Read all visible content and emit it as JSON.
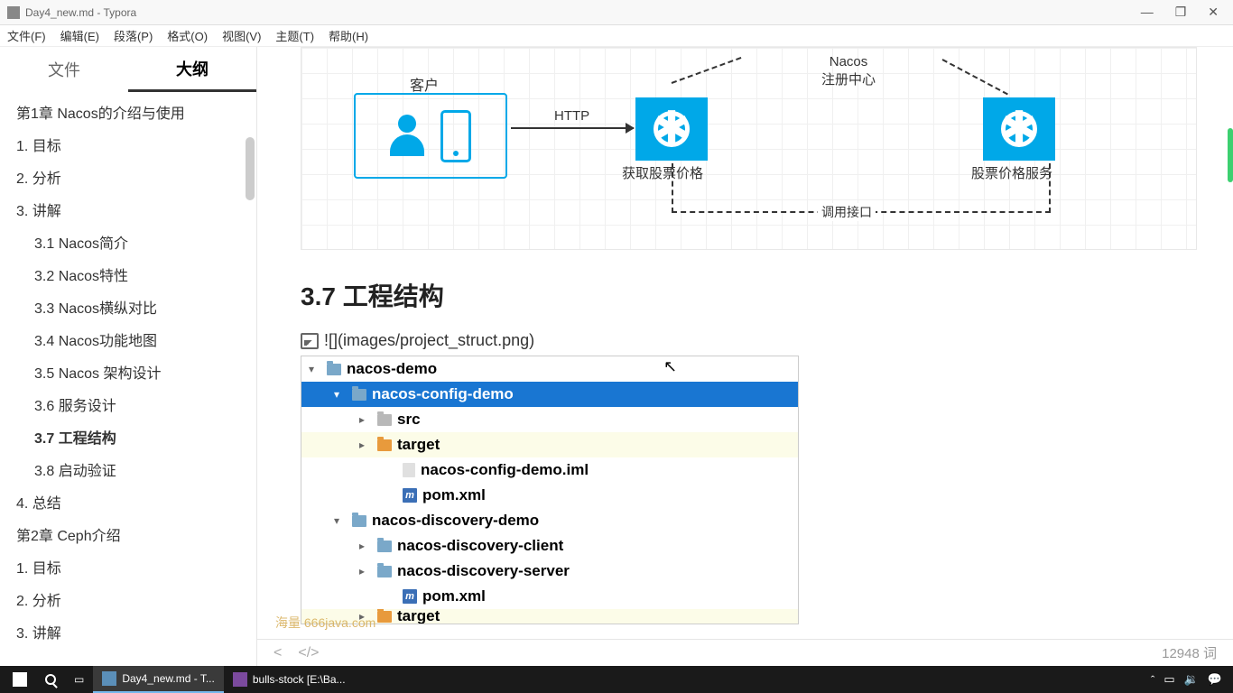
{
  "window": {
    "title": "Day4_new.md - Typora",
    "controls": {
      "min": "—",
      "max": "❐",
      "close": "✕"
    }
  },
  "menu": [
    "文件(F)",
    "编辑(E)",
    "段落(P)",
    "格式(O)",
    "视图(V)",
    "主题(T)",
    "帮助(H)"
  ],
  "sidebar": {
    "tabs": {
      "files": "文件",
      "outline": "大纲"
    },
    "outline": [
      {
        "label": "第1章 Nacos的介绍与使用",
        "level": 1,
        "truncated": true
      },
      {
        "label": "1. 目标",
        "level": 1
      },
      {
        "label": "2. 分析",
        "level": 1
      },
      {
        "label": "3. 讲解",
        "level": 1
      },
      {
        "label": "3.1 Nacos简介",
        "level": 2
      },
      {
        "label": "3.2 Nacos特性",
        "level": 2
      },
      {
        "label": "3.3 Nacos横纵对比",
        "level": 2
      },
      {
        "label": "3.4 Nacos功能地图",
        "level": 2
      },
      {
        "label": "3.5 Nacos 架构设计",
        "level": 2
      },
      {
        "label": "3.6 服务设计",
        "level": 2
      },
      {
        "label": "3.7 工程结构",
        "level": 2,
        "active": true
      },
      {
        "label": "3.8 启动验证",
        "level": 2
      },
      {
        "label": "4. 总结",
        "level": 1
      },
      {
        "label": "第2章 Ceph介绍",
        "level": 1
      },
      {
        "label": "1. 目标",
        "level": 1
      },
      {
        "label": "2. 分析",
        "level": 1
      },
      {
        "label": "3. 讲解",
        "level": 1
      }
    ]
  },
  "diagram": {
    "client": "客户",
    "http": "HTTP",
    "svc1": "获取股票价格",
    "nacos": "Nacos\n注册中心",
    "svc2": "股票价格服务",
    "call": "调用接口"
  },
  "content": {
    "heading": "3.7  工程结构",
    "img_syntax": "![](images/project_struct.png)"
  },
  "tree": [
    {
      "indent": 0,
      "chev": "▾",
      "icon": "folder",
      "label": "nacos-demo"
    },
    {
      "indent": 1,
      "chev": "▾",
      "icon": "folder",
      "label": "nacos-config-demo",
      "selected": true
    },
    {
      "indent": 2,
      "chev": "▸",
      "icon": "folder-gray",
      "label": "src"
    },
    {
      "indent": 2,
      "chev": "▸",
      "icon": "folder-orange",
      "label": "target",
      "highlight": true
    },
    {
      "indent": 3,
      "chev": "",
      "icon": "file",
      "label": "nacos-config-demo.iml"
    },
    {
      "indent": 3,
      "chev": "",
      "icon": "m",
      "label": "pom.xml"
    },
    {
      "indent": 1,
      "chev": "▾",
      "icon": "folder",
      "label": "nacos-discovery-demo"
    },
    {
      "indent": 2,
      "chev": "▸",
      "icon": "folder",
      "label": "nacos-discovery-client"
    },
    {
      "indent": 2,
      "chev": "▸",
      "icon": "folder",
      "label": "nacos-discovery-server"
    },
    {
      "indent": 3,
      "chev": "",
      "icon": "m",
      "label": "pom.xml"
    },
    {
      "indent": 2,
      "chev": "▸",
      "icon": "folder-orange",
      "label": "target",
      "highlight": true,
      "cut": true
    }
  ],
  "statusbar": {
    "back": "<",
    "code": "</>",
    "wordcount": "12948 词"
  },
  "watermark": "海量   666java.com",
  "taskbar": {
    "items": [
      {
        "label": "Day4_new.md - T...",
        "active": true
      },
      {
        "label": "bulls-stock [E:\\Ba...",
        "active": false
      }
    ],
    "tray": {
      "up": "ˆ",
      "ime": "▭",
      "sound": "🔉",
      "notif": "💬"
    }
  }
}
